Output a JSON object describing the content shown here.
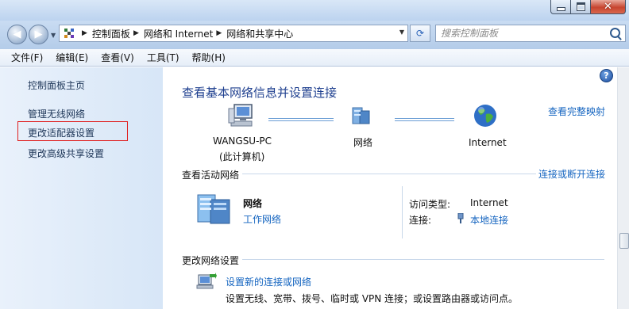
{
  "window": {
    "buttons": [
      "minimize",
      "maximize",
      "close"
    ]
  },
  "navigation": {
    "breadcrumbs": [
      "控制面板",
      "网络和 Internet",
      "网络和共享中心"
    ],
    "search_placeholder": "搜索控制面板"
  },
  "menu": [
    "文件(F)",
    "编辑(E)",
    "查看(V)",
    "工具(T)",
    "帮助(H)"
  ],
  "sidebar": {
    "items": [
      {
        "label": "控制面板主页"
      },
      {
        "label": "管理无线网络"
      },
      {
        "label": "更改适配器设置",
        "highlighted": true
      },
      {
        "label": "更改高级共享设置"
      }
    ]
  },
  "main": {
    "heading": "查看基本网络信息并设置连接",
    "full_map_link": "查看完整映射",
    "map": {
      "computer_name": "WANGSU-PC",
      "computer_sub": "(此计算机)",
      "network": "网络",
      "internet": "Internet"
    },
    "active_section": {
      "title": "查看活动网络",
      "connect_link": "连接或断开连接",
      "network_name": "网络",
      "network_type": "工作网络",
      "access_type_label": "访问类型:",
      "access_type_value": "Internet",
      "connection_label": "连接:",
      "connection_value": "本地连接"
    },
    "change_section": {
      "title": "更改网络设置",
      "setup_link": "设置新的连接或网络",
      "setup_desc": "设置无线、宽带、拨号、临时或 VPN 连接；或设置路由器或访问点。"
    }
  },
  "colors": {
    "link": "#1565c0",
    "heading": "#1e3f8f",
    "highlight_box": "#e01f1f"
  }
}
